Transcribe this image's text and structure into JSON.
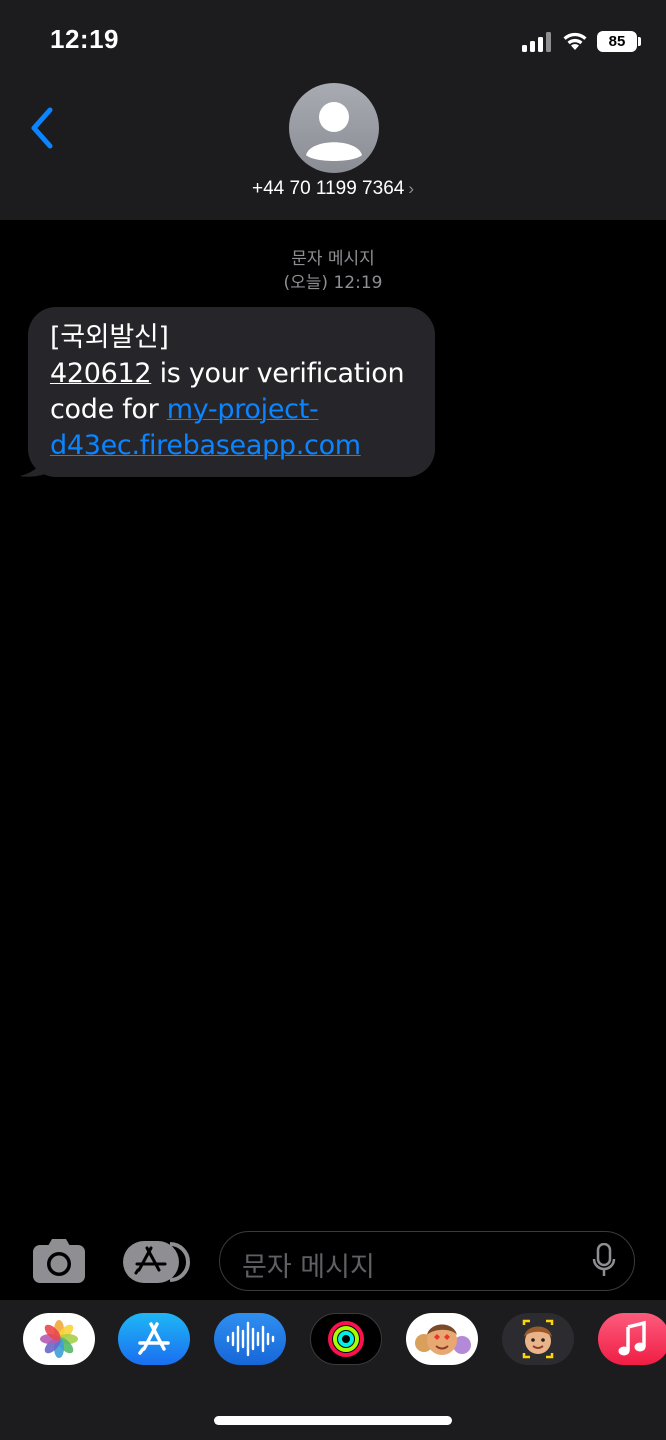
{
  "status_bar": {
    "time": "12:19",
    "battery": "85",
    "icons": [
      "signal-icon",
      "wifi-icon",
      "battery-icon"
    ]
  },
  "header": {
    "back_icon": "chevron-left-icon",
    "avatar_icon": "person-icon",
    "contact": "+44 70 1199 7364",
    "chevron": "›"
  },
  "thread": {
    "timestamp_line1": "문자 메시지",
    "timestamp_line2": "(오늘) 12:19",
    "message": {
      "prefix": "[국외발신]",
      "code": "420612",
      "text_after_code": " is your verification code for ",
      "link_line1": "my-project-",
      "link_line2": "d43ec.firebaseapp.com"
    }
  },
  "input_bar": {
    "camera_icon": "camera-icon",
    "apps_icon": "app-store-icon",
    "placeholder": "문자 메시지",
    "mic_icon": "microphone-icon"
  },
  "app_drawer": {
    "apps": [
      "photos-icon",
      "app-store-icon",
      "audio-message-icon",
      "activity-icon",
      "memoji-stickers-icon",
      "memoji-icon",
      "music-icon"
    ]
  },
  "colors": {
    "accent": "#0b84ff",
    "bubble": "#26262a",
    "header": "#1c1c1e",
    "background": "#000000"
  }
}
